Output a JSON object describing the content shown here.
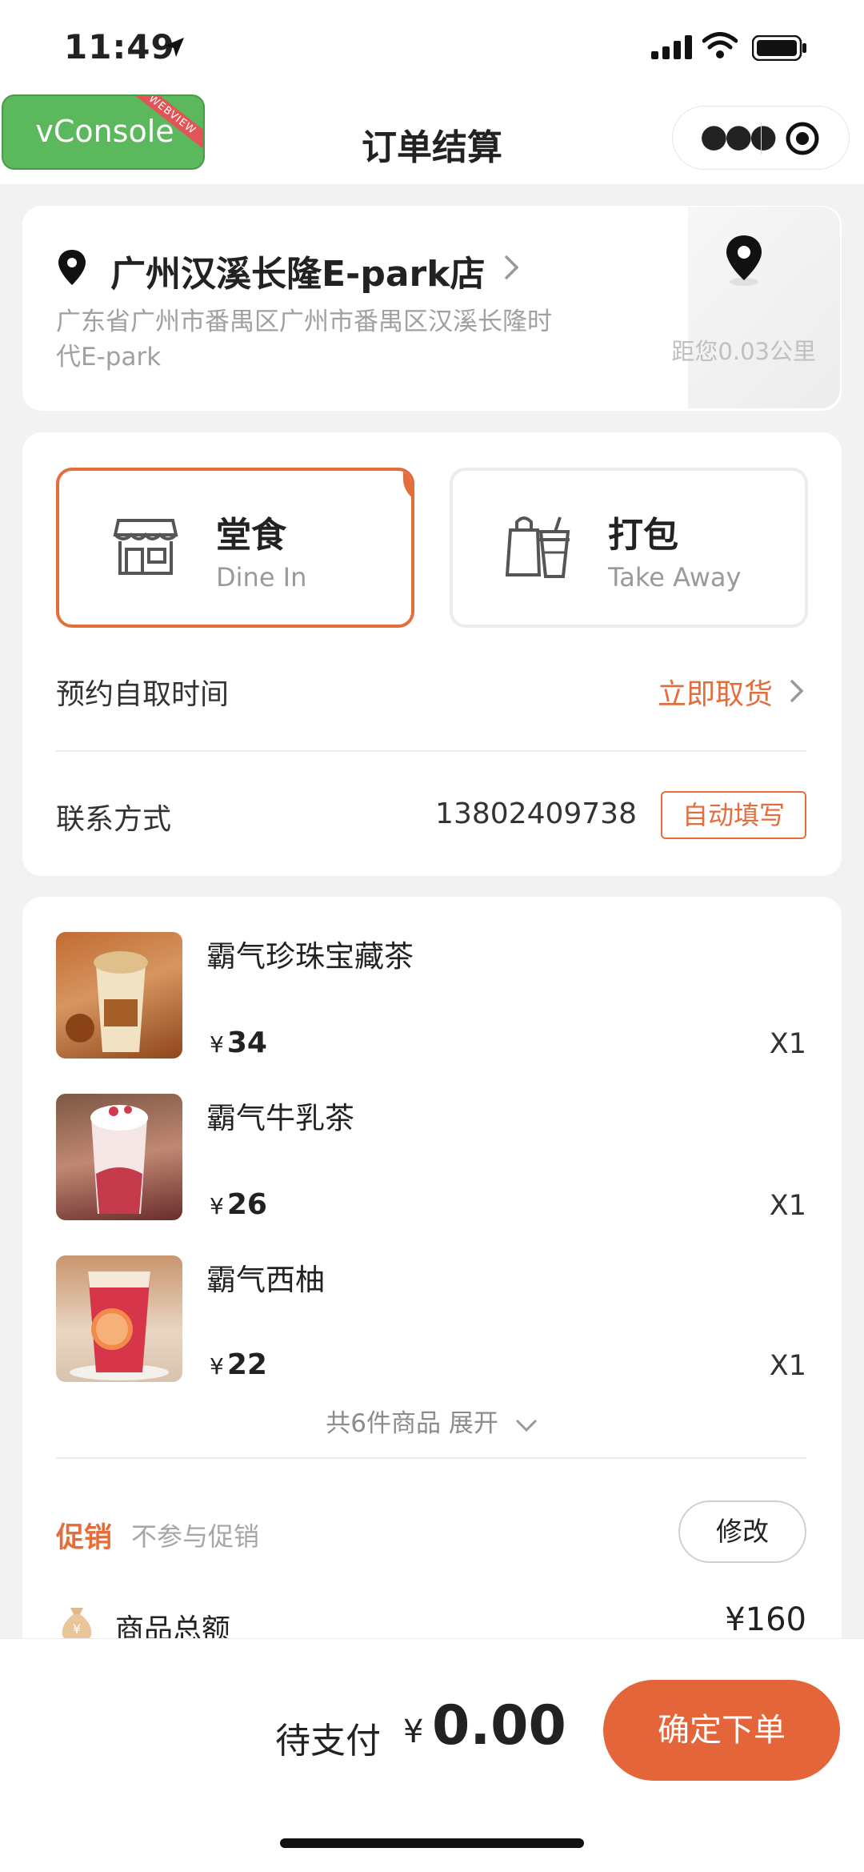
{
  "status_bar": {
    "time": "11:49"
  },
  "vconsole": {
    "label": "vConsole",
    "ribbon": "WEBVIEW"
  },
  "header": {
    "title": "订单结算"
  },
  "store": {
    "name": "广州汉溪长隆E-park店",
    "address": "广东省广州市番禺区广州市番禺区汉溪长隆时代E-park",
    "distance": "距您0.03公里"
  },
  "order_mode": {
    "dine_in": {
      "cn": "堂食",
      "en": "Dine In",
      "selected": true
    },
    "take_away": {
      "cn": "打包",
      "en": "Take Away",
      "selected": false
    }
  },
  "pickup": {
    "label": "预约自取时间",
    "value": "立即取货"
  },
  "contact": {
    "label": "联系方式",
    "phone": "13802409738",
    "autofill_label": "自动填写"
  },
  "items": [
    {
      "name": "霸气珍珠宝藏茶",
      "price": "34",
      "qty": "X1"
    },
    {
      "name": "霸气牛乳茶",
      "price": "26",
      "qty": "X1"
    },
    {
      "name": "霸气西柚",
      "price": "22",
      "qty": "X1"
    }
  ],
  "currency_symbol": "¥",
  "expand": {
    "label": "共6件商品 展开"
  },
  "promotion": {
    "label": "促销",
    "value": "不参与促销",
    "edit_label": "修改"
  },
  "subtotal": {
    "label": "商品总额",
    "value": "¥160"
  },
  "footer": {
    "pay_label": "待支付",
    "currency": "¥",
    "amount": "0.00",
    "submit_label": "确定下单"
  },
  "colors": {
    "accent": "#e46d3c",
    "vconsole": "#5cb85c"
  }
}
